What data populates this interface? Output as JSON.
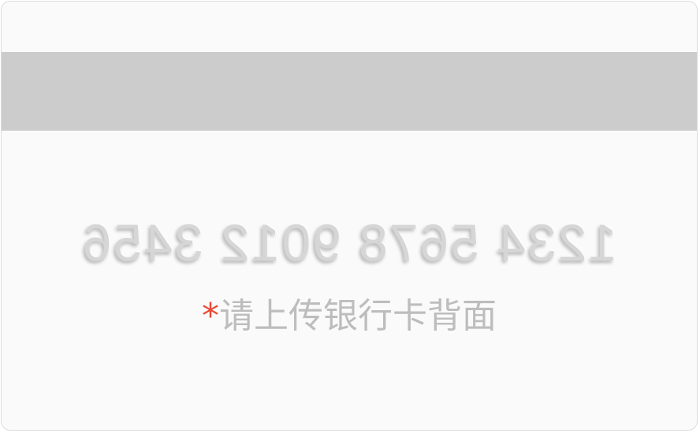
{
  "card": {
    "number": "1234 5678 9012 3456",
    "required_mark": "*",
    "upload_hint": "请上传银行卡背面"
  },
  "colors": {
    "card_background": "#fafafa",
    "stripe": "#cccccc",
    "required_mark": "#e94a35",
    "hint_text": "#bdbdbd"
  }
}
